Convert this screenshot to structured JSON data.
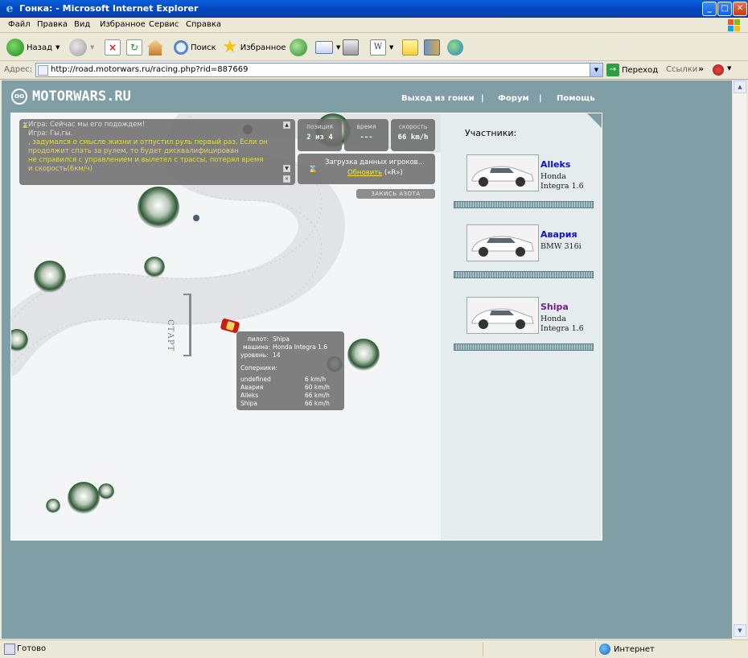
{
  "window": {
    "title": "Гонка: - Microsoft Internet Explorer",
    "minimize": "_",
    "maximize": "□",
    "close": "✕"
  },
  "menu": {
    "items": [
      "Файл",
      "Правка",
      "Вид",
      "Избранное",
      "Сервис",
      "Справка"
    ]
  },
  "toolbar": {
    "back": "Назад",
    "search": "Поиск",
    "favorites": "Избранное"
  },
  "address": {
    "label": "Адрес:",
    "url": "http://road.motorwars.ru/racing.php?rid=887669",
    "go": "Переход",
    "links": "Ссылки"
  },
  "site": {
    "logo": "MOTORWARS.RU",
    "nav": [
      "Выход из гонки",
      "|",
      "Форум",
      "|",
      "Помощь"
    ]
  },
  "chat": {
    "lines": [
      {
        "text": "Игра: Сейчас мы его подождем!",
        "style": "sys"
      },
      {
        "text": "Игра: Гы,гы.",
        "style": "sys"
      },
      {
        "text": ", задумался о смысле жизни и отпустил руль первый раз. Если он",
        "style": "yl"
      },
      {
        "text": "продолжит спать за рулем, то будет дисквалифицирован",
        "style": "yl"
      },
      {
        "text": " не справился с управлением и вылетел с трассы, потерял время",
        "style": "yl"
      },
      {
        "text": "и скорость(6км/ч)",
        "style": "yl"
      }
    ]
  },
  "stats": {
    "position_label": "позиция",
    "position_value": "2 из 4",
    "time_label": "время",
    "time_value": "---",
    "speed_label": "скорость",
    "speed_value": "66 km/h"
  },
  "loading": {
    "text": "Загрузка данных игроков...",
    "refresh": "Обновить",
    "hotkey": "(«R»)"
  },
  "nitro": "ЗАКИСЬ АЗОТА",
  "start_label": "СТАРТ",
  "info": {
    "pilot_label": "пилот:",
    "pilot": "Shipa",
    "car_label": "машина:",
    "car": "Honda Integra 1.6",
    "level_label": "уровень:",
    "level": "14",
    "rivals_label": "Соперники:",
    "rivals": [
      {
        "name": "undefined",
        "speed": "6 km/h"
      },
      {
        "name": "Авария",
        "speed": "60 km/h"
      },
      {
        "name": "Alleks",
        "speed": "66 km/h"
      },
      {
        "name": "Shipa",
        "speed": "66 km/h"
      }
    ]
  },
  "participants": {
    "title": "Участники:",
    "list": [
      {
        "name": "Alleks",
        "model_line1": "Honda",
        "model_line2": "Integra 1.6",
        "color": "#1010c8"
      },
      {
        "name": "Авария",
        "model_line1": "BMW 316i",
        "model_line2": "",
        "color": "#1010c8"
      },
      {
        "name": "Shipa",
        "model_line1": "Honda",
        "model_line2": "Integra 1.6",
        "color": "#7a1a8a"
      }
    ]
  },
  "status": {
    "text": "Готово",
    "zone": "Интернет"
  }
}
